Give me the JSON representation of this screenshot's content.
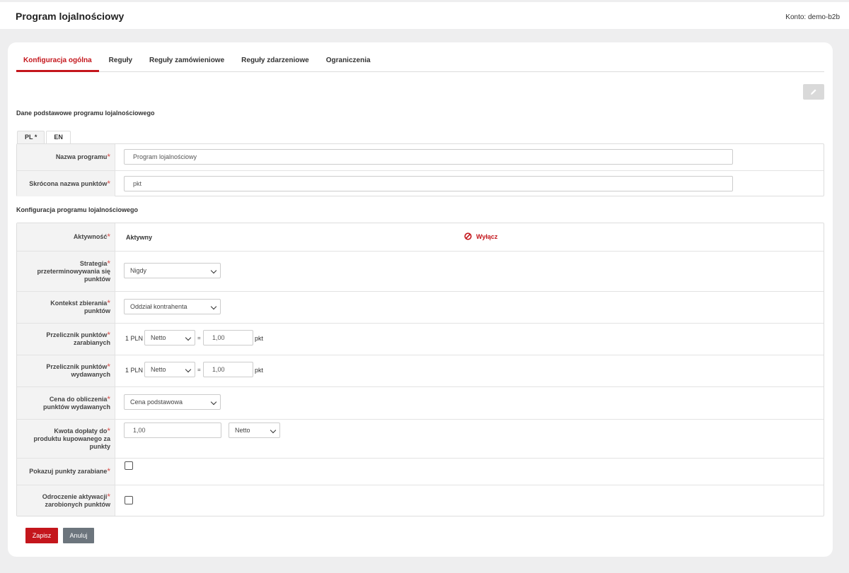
{
  "header": {
    "title": "Program lojalnościowy",
    "account_label": "Konto: demo-b2b"
  },
  "tabs": [
    {
      "label": "Konfiguracja ogólna",
      "active": true
    },
    {
      "label": "Reguły"
    },
    {
      "label": "Reguły zamówieniowe"
    },
    {
      "label": "Reguły zdarzeniowe"
    },
    {
      "label": "Ograniczenia"
    }
  ],
  "sections": {
    "basic_title": "Dane podstawowe programu lojalnościowego",
    "config_title": "Konfiguracja programu lojalnościowego"
  },
  "lang_tabs": [
    {
      "label": "PL *",
      "active": true
    },
    {
      "label": "EN"
    }
  ],
  "basic_fields": {
    "program_name_label": "Nazwa programu",
    "program_name_value": "Program lojalnościowy",
    "points_short_label": "Skrócona nazwa punktów",
    "points_short_value": "pkt"
  },
  "config": {
    "activity_label": "Aktywność",
    "activity_value": "Aktywny",
    "deactivate_label": "Wyłącz",
    "expiry_label_1": "Strategia",
    "expiry_label_2": "przeterminowywania się",
    "expiry_label_3": "punktów",
    "expiry_value": "Nigdy",
    "context_label_1": "Kontekst zbierania",
    "context_label_2": "punktów",
    "context_value": "Oddział kontrahenta",
    "earn_label_1": "Przelicznik punktów",
    "earn_label_2": "zarabianych",
    "earn_prefix": "1 PLN",
    "earn_price_type": "Netto",
    "equals": "=",
    "earn_value": "1,00",
    "earn_unit": "pkt",
    "spend_label_1": "Przelicznik punktów",
    "spend_label_2": "wydawanych",
    "spend_prefix": "1 PLN",
    "spend_price_type": "Netto",
    "spend_value": "1,00",
    "spend_unit": "pkt",
    "price_label_1": "Cena do obliczenia",
    "price_label_2": "punktów wydawanych",
    "price_value": "Cena podstawowa",
    "surcharge_label_1": "Kwota dopłaty do",
    "surcharge_label_2": "produktu kupowanego za",
    "surcharge_label_3": "punkty",
    "surcharge_value": "1,00",
    "surcharge_type": "Netto",
    "show_points_label": "Pokazuj punkty zarabiane",
    "show_points_checked": false,
    "delay_label_1": "Odroczenie aktywacji",
    "delay_label_2": "zarobionych punktów",
    "delay_checked": false,
    "required_mark": "*"
  },
  "actions": {
    "save_label": "Zapisz",
    "cancel_label": "Anuluj"
  },
  "colors": {
    "accent": "#c4161c",
    "cancel": "#6c757d"
  }
}
